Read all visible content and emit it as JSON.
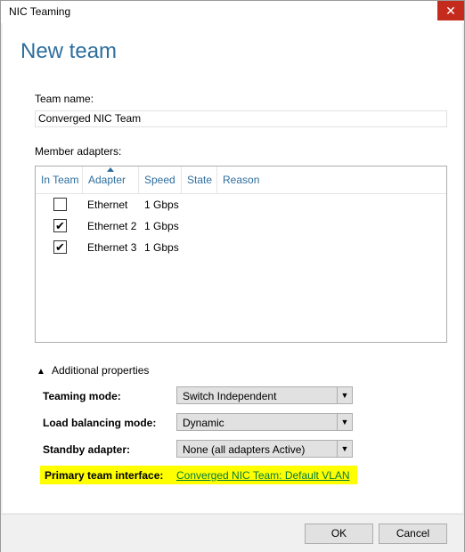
{
  "window": {
    "title": "NIC Teaming",
    "close_glyph": "✕"
  },
  "heading": "New team",
  "team_name": {
    "label": "Team name:",
    "value": "Converged NIC Team"
  },
  "member_adapters": {
    "label": "Member adapters:",
    "columns": [
      "In Team",
      "Adapter",
      "Speed",
      "State",
      "Reason"
    ],
    "rows": [
      {
        "in_team": false,
        "adapter": "Ethernet",
        "speed": "1 Gbps",
        "state": "",
        "reason": ""
      },
      {
        "in_team": true,
        "adapter": "Ethernet 2",
        "speed": "1 Gbps",
        "state": "",
        "reason": ""
      },
      {
        "in_team": true,
        "adapter": "Ethernet 3",
        "speed": "1 Gbps",
        "state": "",
        "reason": ""
      }
    ],
    "sorted_column": "Adapter"
  },
  "additional_properties": {
    "label": "Additional properties",
    "teaming_mode": {
      "label": "Teaming mode:",
      "value": "Switch Independent"
    },
    "load_balancing_mode": {
      "label": "Load balancing mode:",
      "value": "Dynamic"
    },
    "standby_adapter": {
      "label": "Standby adapter:",
      "value": "None (all adapters Active)"
    },
    "primary_team_interface": {
      "label": "Primary team interface:",
      "value": "Converged NIC Team: Default VLAN"
    }
  },
  "buttons": {
    "ok": "OK",
    "cancel": "Cancel"
  },
  "colors": {
    "heading": "#2e6e9e",
    "highlight": "#ffff00",
    "link": "#007a3d",
    "close": "#c42b1c"
  },
  "icons": {
    "checkmark": "✔",
    "caret_up": "▲",
    "dropdown_arrow": "▼"
  }
}
